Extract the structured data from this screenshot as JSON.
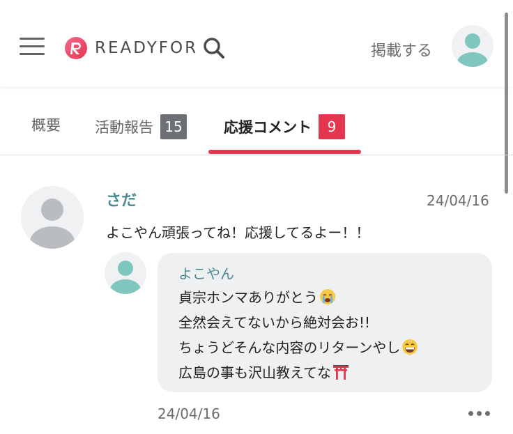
{
  "header": {
    "logo_text": "READYFOR",
    "publish_label": "掲載する"
  },
  "tabs": [
    {
      "label": "概要"
    },
    {
      "label": "活動報告",
      "count": "15"
    },
    {
      "label": "応援コメント",
      "count": "9"
    }
  ],
  "comment": {
    "author": "さだ",
    "date": "24/04/16",
    "body": "よこやん頑張ってね！応援してるよー！！",
    "reply": {
      "author": "よこやん",
      "lines": [
        "貞宗ホンマありがとう",
        "全然会えてないから絶対会お!!",
        "ちょうどそんな内容のリターンやし",
        "広島の事も沢山教えてな"
      ],
      "line_emojis": [
        "loudly-crying-face-emoji",
        "",
        "grinning-face-emoji",
        "torii-gate-emoji"
      ],
      "date": "24/04/16"
    }
  },
  "colors": {
    "accent": "#e5364f",
    "teal": "#4d8a93",
    "badge_gray": "#6d7175"
  }
}
